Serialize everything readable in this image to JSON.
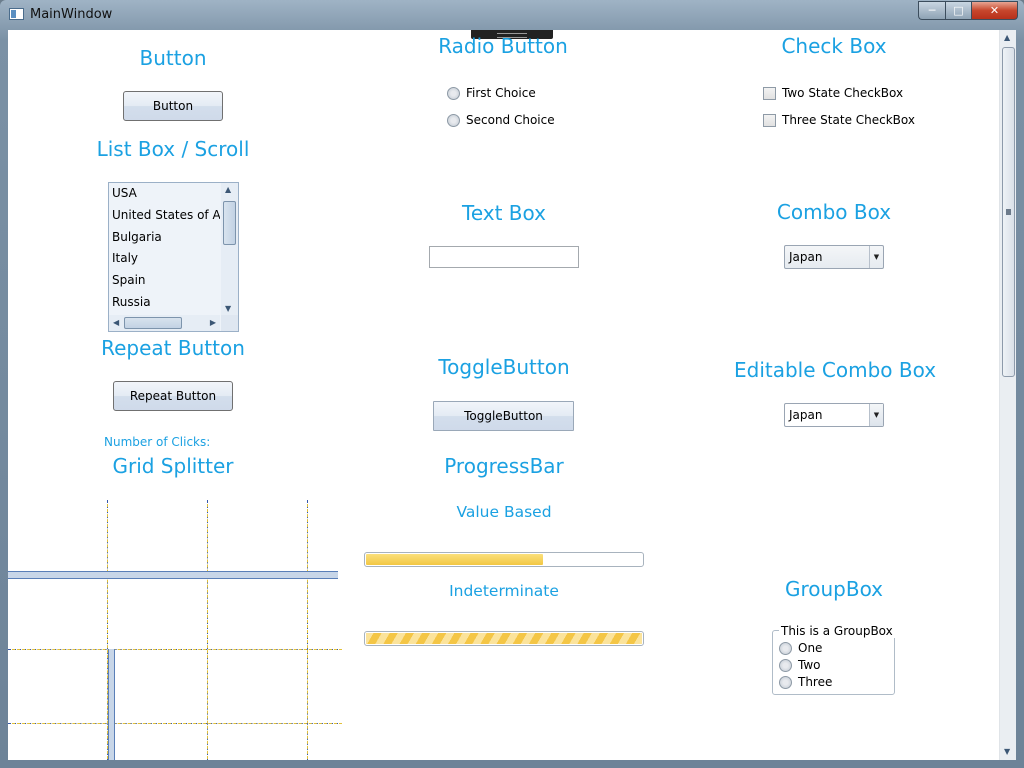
{
  "window": {
    "title": "MainWindow"
  },
  "sections": {
    "button": {
      "title": "Button",
      "button_label": "Button"
    },
    "listbox": {
      "title": "List Box / Scroll",
      "items": [
        "USA",
        "United States of Ar",
        "Bulgaria",
        "Italy",
        "Spain",
        "Russia"
      ]
    },
    "repeat": {
      "title": "Repeat Button",
      "button_label": "Repeat Button",
      "clicks_label": "Number of Clicks:"
    },
    "grid_splitter": {
      "title": "Grid Splitter"
    },
    "radio": {
      "title": "Radio Button",
      "options": [
        "First Choice",
        "Second Choice"
      ]
    },
    "textbox": {
      "title": "Text Box",
      "value": ""
    },
    "toggle": {
      "title": "ToggleButton",
      "button_label": "ToggleButton"
    },
    "progress": {
      "title": "ProgressBar",
      "value_title": "Value Based",
      "indeterminate_title": "Indeterminate",
      "value_fraction": 0.64
    },
    "checkbox": {
      "title": "Check Box",
      "options": [
        "Two State CheckBox",
        "Three State CheckBox"
      ]
    },
    "combo": {
      "title": "Combo Box",
      "selected": "Japan"
    },
    "editable_combo": {
      "title": "Editable Combo Box",
      "selected": "Japan"
    },
    "groupbox": {
      "title": "GroupBox",
      "header": "This is a GroupBox",
      "options": [
        "One",
        "Two",
        "Three"
      ]
    }
  },
  "colors": {
    "heading": "#1ba1e2",
    "progress_fill": "#f2c744"
  }
}
